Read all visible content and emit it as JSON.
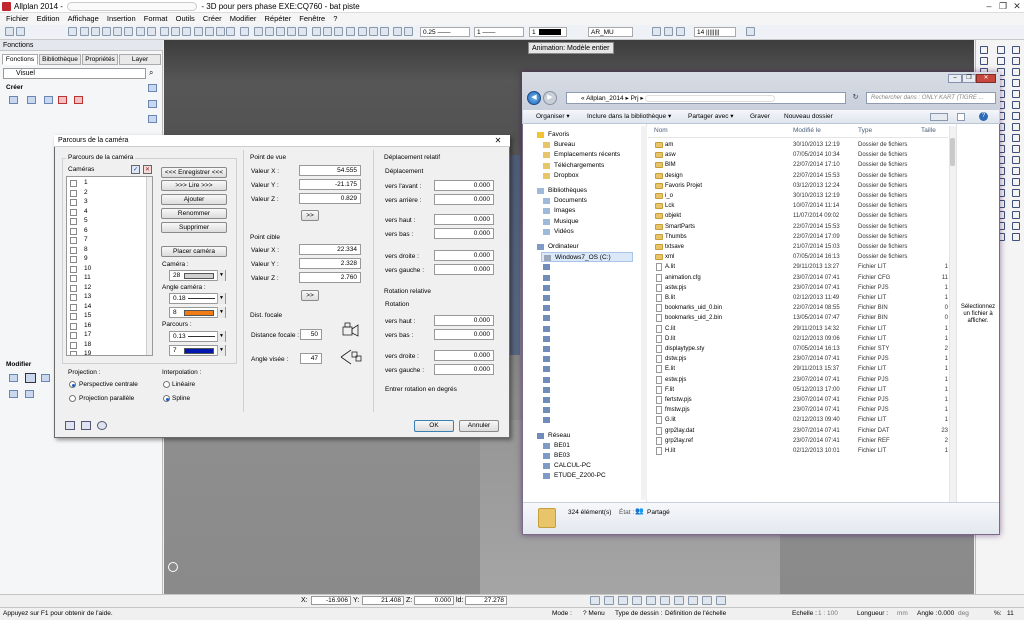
{
  "app": {
    "title_prefix": "Allplan 2014 -",
    "title_suffix": "- 3D pour pers phase EXE:CQ760 - bat piste",
    "window_controls": [
      "–",
      "❐",
      "✕"
    ]
  },
  "menu": [
    "Fichier",
    "Edition",
    "Affichage",
    "Insertion",
    "Format",
    "Outils",
    "Créer",
    "Modifier",
    "Répéter",
    "Fenêtre",
    "?"
  ],
  "toolbar": {
    "pen_value": "0.25",
    "line_value": "1",
    "color_value": "1",
    "layer_value": "AR_MU",
    "scale_value": "14"
  },
  "tooltip": "Animation: Modèle entier",
  "left_panel": {
    "title": "Fonctions",
    "tabs": [
      "Fonctions",
      "Bibliothèque",
      "Propriétés",
      "Layer"
    ],
    "dropdown": "Visuel",
    "section_create": "Créer",
    "section_modify": "Modifier"
  },
  "camera_dialog": {
    "title": "Parcours de la caméra",
    "path_group": "Parcours de la caméra",
    "cameras_label": "Caméras",
    "camera_list": [
      "1",
      "2",
      "3",
      "4",
      "5",
      "6",
      "7",
      "8",
      "9",
      "10",
      "11",
      "12",
      "13",
      "14",
      "15",
      "16",
      "17",
      "18",
      "19"
    ],
    "buttons": {
      "record": "<<< Enregistrer <<<",
      "read": ">>> Lire >>>",
      "add": "Ajouter",
      "rename": "Renommer",
      "delete": "Supprimer",
      "place": "Placer caméra",
      "ok": "OK",
      "cancel": "Annuler",
      "arrow": ">>"
    },
    "camera_label": "Caméra :",
    "camera_pen": "28",
    "camera_angle_label": "Angle caméra :",
    "camera_angle_value": "0.18",
    "camera_angle_pen": "8",
    "path_label": "Parcours :",
    "path_value": "0.13",
    "path_pen": "7",
    "projection_label": "Projection :",
    "proj_perspective": "Perspective centrale",
    "proj_parallel": "Projection parallèle",
    "interp_label": "Interpolation :",
    "interp_linear": "Linéaire",
    "interp_spline": "Spline",
    "viewpoint": {
      "title": "Point de vue",
      "x_label": "Valeur X :",
      "x": "54.555",
      "y_label": "Valeur Y :",
      "y": "-21.175",
      "z_label": "Valeur Z :",
      "z": "0.829"
    },
    "target": {
      "title": "Point cible",
      "x_label": "Valeur X :",
      "x": "22.334",
      "y_label": "Valeur Y :",
      "y": "2.328",
      "z_label": "Valeur Z :",
      "z": "2.760"
    },
    "focal": {
      "title": "Dist. focale",
      "distance_label": "Distance focale :",
      "distance": "50",
      "angle_label": "Angle visée :",
      "angle": "47"
    },
    "relative_move": {
      "title": "Déplacement relatif",
      "sub": "Déplacement",
      "forward_label": "vers l'avant :",
      "forward": "0.000",
      "backward_label": "vers arrière :",
      "backward": "0.000",
      "up_label": "vers haut :",
      "up": "0.000",
      "down_label": "vers bas :",
      "down": "0.000",
      "right_label": "vers droite :",
      "right": "0.000",
      "left_label": "vers gauche :",
      "left": "0.000"
    },
    "relative_rotation": {
      "title": "Rotation relative",
      "sub": "Rotation",
      "up_label": "vers haut :",
      "up": "0.000",
      "down_label": "vers bas :",
      "down": "0.000",
      "right_label": "vers droite :",
      "right": "0.000",
      "left_label": "vers gauche :",
      "left": "0.000",
      "hint": "Entrer rotation en degrés"
    }
  },
  "explorer": {
    "address_parts": [
      "«",
      "Allplan_2014",
      "▸",
      "Prj",
      "▸"
    ],
    "search_placeholder": "Rechercher dans : ONLY KART (TIGRE ...",
    "commands": [
      "Organiser ▾",
      "Inclure dans la bibliothèque ▾",
      "Partager avec ▾",
      "Graver",
      "Nouveau dossier"
    ],
    "columns": [
      "Nom",
      "Modifié le",
      "Type",
      "Taille"
    ],
    "nav": [
      {
        "label": "Favoris",
        "level": 0,
        "kind": "star"
      },
      {
        "label": "Bureau",
        "level": 1,
        "kind": "folder"
      },
      {
        "label": "Emplacements récents",
        "level": 1,
        "kind": "folder"
      },
      {
        "label": "Téléchargements",
        "level": 1,
        "kind": "folder"
      },
      {
        "label": "Dropbox",
        "level": 1,
        "kind": "folder"
      },
      {
        "label": "",
        "level": 0,
        "kind": "gap"
      },
      {
        "label": "Bibliothèques",
        "level": 0,
        "kind": "lib"
      },
      {
        "label": "Documents",
        "level": 1,
        "kind": "lib"
      },
      {
        "label": "Images",
        "level": 1,
        "kind": "lib"
      },
      {
        "label": "Musique",
        "level": 1,
        "kind": "lib"
      },
      {
        "label": "Vidéos",
        "level": 1,
        "kind": "lib"
      },
      {
        "label": "",
        "level": 0,
        "kind": "gap"
      },
      {
        "label": "Ordinateur",
        "level": 0,
        "kind": "pc"
      },
      {
        "label": "Windows7_OS (C:)",
        "level": 1,
        "kind": "drive"
      },
      {
        "label": "",
        "level": 1,
        "kind": "net"
      },
      {
        "label": "",
        "level": 1,
        "kind": "net"
      },
      {
        "label": "",
        "level": 1,
        "kind": "net"
      },
      {
        "label": "",
        "level": 1,
        "kind": "net"
      },
      {
        "label": "",
        "level": 1,
        "kind": "net"
      },
      {
        "label": "",
        "level": 1,
        "kind": "net"
      },
      {
        "label": "",
        "level": 1,
        "kind": "net"
      },
      {
        "label": "",
        "level": 1,
        "kind": "net"
      },
      {
        "label": "",
        "level": 1,
        "kind": "net"
      },
      {
        "label": "",
        "level": 1,
        "kind": "net"
      },
      {
        "label": "",
        "level": 1,
        "kind": "net"
      },
      {
        "label": "",
        "level": 1,
        "kind": "net"
      },
      {
        "label": "",
        "level": 1,
        "kind": "net"
      },
      {
        "label": "",
        "level": 1,
        "kind": "net"
      },
      {
        "label": "",
        "level": 1,
        "kind": "net"
      },
      {
        "label": "",
        "level": 1,
        "kind": "net"
      },
      {
        "label": "",
        "level": 0,
        "kind": "gap"
      },
      {
        "label": "Réseau",
        "level": 0,
        "kind": "net"
      },
      {
        "label": "BE01",
        "level": 1,
        "kind": "pc"
      },
      {
        "label": "BE03",
        "level": 1,
        "kind": "pc"
      },
      {
        "label": "CALCUL-PC",
        "level": 1,
        "kind": "pc"
      },
      {
        "label": "ETUDE_Z200-PC",
        "level": 1,
        "kind": "pc"
      }
    ],
    "files": [
      {
        "name": "am",
        "date": "30/10/2013 12:19",
        "type": "Dossier de fichiers",
        "size": "",
        "folder": true
      },
      {
        "name": "asw",
        "date": "07/05/2014 10:34",
        "type": "Dossier de fichiers",
        "size": "",
        "folder": true
      },
      {
        "name": "BIM",
        "date": "22/07/2014 17:10",
        "type": "Dossier de fichiers",
        "size": "",
        "folder": true
      },
      {
        "name": "design",
        "date": "22/07/2014 15:53",
        "type": "Dossier de fichiers",
        "size": "",
        "folder": true
      },
      {
        "name": "Favoris Projet",
        "date": "03/12/2013 12:24",
        "type": "Dossier de fichiers",
        "size": "",
        "folder": true
      },
      {
        "name": "i_o",
        "date": "30/10/2013 12:19",
        "type": "Dossier de fichiers",
        "size": "",
        "folder": true
      },
      {
        "name": "Lck",
        "date": "10/07/2014 11:14",
        "type": "Dossier de fichiers",
        "size": "",
        "folder": true
      },
      {
        "name": "objekt",
        "date": "11/07/2014 09:02",
        "type": "Dossier de fichiers",
        "size": "",
        "folder": true
      },
      {
        "name": "SmartParts",
        "date": "22/07/2014 15:53",
        "type": "Dossier de fichiers",
        "size": "",
        "folder": true
      },
      {
        "name": "Thumbs",
        "date": "22/07/2014 17:09",
        "type": "Dossier de fichiers",
        "size": "",
        "folder": true
      },
      {
        "name": "txtsave",
        "date": "21/07/2014 15:03",
        "type": "Dossier de fichiers",
        "size": "",
        "folder": true
      },
      {
        "name": "xml",
        "date": "07/05/2014 16:13",
        "type": "Dossier de fichiers",
        "size": "",
        "folder": true
      },
      {
        "name": "A.lit",
        "date": "29/11/2013 13:27",
        "type": "Fichier LIT",
        "size": "1",
        "folder": false
      },
      {
        "name": "animation.cfg",
        "date": "23/07/2014 07:41",
        "type": "Fichier CFG",
        "size": "11",
        "folder": false
      },
      {
        "name": "astw.pjs",
        "date": "23/07/2014 07:41",
        "type": "Fichier PJS",
        "size": "1",
        "folder": false
      },
      {
        "name": "B.lit",
        "date": "02/12/2013 11:49",
        "type": "Fichier LIT",
        "size": "1",
        "folder": false
      },
      {
        "name": "bookmarks_uid_0.bin",
        "date": "22/07/2014 08:55",
        "type": "Fichier BIN",
        "size": "0",
        "folder": false
      },
      {
        "name": "bookmarks_uid_2.bin",
        "date": "13/05/2014 07:47",
        "type": "Fichier BIN",
        "size": "0",
        "folder": false
      },
      {
        "name": "C.lit",
        "date": "29/11/2013 14:32",
        "type": "Fichier LIT",
        "size": "1",
        "folder": false
      },
      {
        "name": "D.lit",
        "date": "02/12/2013 09:06",
        "type": "Fichier LIT",
        "size": "1",
        "folder": false
      },
      {
        "name": "displaytype.sty",
        "date": "07/05/2014 16:13",
        "type": "Fichier STY",
        "size": "2",
        "folder": false
      },
      {
        "name": "dstw.pjs",
        "date": "23/07/2014 07:41",
        "type": "Fichier PJS",
        "size": "1",
        "folder": false
      },
      {
        "name": "E.lit",
        "date": "29/11/2013 15:37",
        "type": "Fichier LIT",
        "size": "1",
        "folder": false
      },
      {
        "name": "estw.pjs",
        "date": "23/07/2014 07:41",
        "type": "Fichier PJS",
        "size": "1",
        "folder": false
      },
      {
        "name": "F.lit",
        "date": "05/12/2013 17:00",
        "type": "Fichier LIT",
        "size": "1",
        "folder": false
      },
      {
        "name": "fertstw.pjs",
        "date": "23/07/2014 07:41",
        "type": "Fichier PJS",
        "size": "1",
        "folder": false
      },
      {
        "name": "fmstw.pjs",
        "date": "23/07/2014 07:41",
        "type": "Fichier PJS",
        "size": "1",
        "folder": false
      },
      {
        "name": "G.lit",
        "date": "02/12/2013 09:40",
        "type": "Fichier LIT",
        "size": "1",
        "folder": false
      },
      {
        "name": "grp2lay.dat",
        "date": "23/07/2014 07:41",
        "type": "Fichier DAT",
        "size": "23",
        "folder": false
      },
      {
        "name": "grp2lay.ref",
        "date": "23/07/2014 07:41",
        "type": "Fichier REF",
        "size": "2",
        "folder": false
      },
      {
        "name": "H.lit",
        "date": "02/12/2013 10:01",
        "type": "Fichier LIT",
        "size": "1",
        "folder": false
      }
    ],
    "preview_text": "Sélectionnez un fichier à afficher.",
    "status_count": "324 élément(s)",
    "status_state_label": "État :",
    "status_state": "Partagé"
  },
  "coords": {
    "x_label": "X:",
    "x": "-16.906",
    "y_label": "Y:",
    "y": "21.408",
    "z_label": "Z:",
    "z": "0.000",
    "d_label": "ld:",
    "d": "27.278"
  },
  "status": {
    "help": "Appuyez sur F1 pour obtenir de l'aide.",
    "mode_label": "Mode :",
    "mode": "? Menu",
    "drawtype_label": "Type de dessin :",
    "drawtype": "Définition de l'échelle",
    "scale_label": "Echelle :",
    "scale": "1 : 100",
    "length_label": "Longueur :",
    "length": "mm",
    "angle_label": "Angle :",
    "angle": "0.000",
    "deg": "deg",
    "pct_label": "%:",
    "pct": "11"
  }
}
